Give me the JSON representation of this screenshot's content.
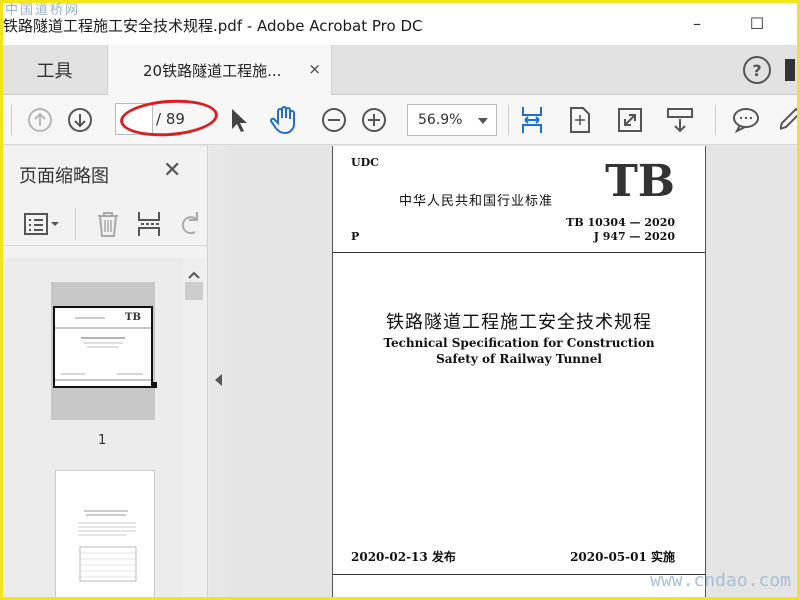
{
  "window": {
    "watermark_top": "中国道桥网",
    "title": "铁路隧道工程施工安全技术规程.pdf - Adobe Acrobat Pro DC",
    "minimize": "–",
    "maximize": "☐"
  },
  "tabs": {
    "tools": "工具",
    "document": "20铁路隧道工程施...",
    "close": "×",
    "help": "?"
  },
  "toolbar": {
    "page_current": "",
    "page_total": "/ 89",
    "zoom": "56.9%"
  },
  "side_panel": {
    "title": "页面缩略图",
    "close": "✕",
    "thumbnail_1_label": "1"
  },
  "document": {
    "udc": "UDC",
    "standard_cn": "中华人民共和国行业标准",
    "tb": "TB",
    "code_1": "TB 10304 — 2020",
    "code_2": "J 947 — 2020",
    "p_mark": "P",
    "title_cn": "铁路隧道工程施工安全技术规程",
    "title_en_1": "Technical Specification for Construction",
    "title_en_2": "Safety of Railway Tunnel",
    "issue": "2020-02-13  发布",
    "implement": "2020-05-01  实施"
  },
  "watermark_bottom": "www.cndao.com",
  "colors": {
    "frame": "#f3e51b",
    "accent_blue": "#1a6fd1",
    "annotation_red": "#d92020"
  },
  "icons": [
    "prev-page-icon",
    "next-page-icon",
    "select-arrow-icon",
    "hand-tool-icon",
    "zoom-out-icon",
    "zoom-in-icon",
    "fit-width-icon",
    "fit-page-icon",
    "full-screen-icon",
    "scroll-mode-icon",
    "comment-icon",
    "pen-icon",
    "thumbnail-options-icon",
    "delete-icon",
    "insert-icon",
    "rotate-icon"
  ]
}
